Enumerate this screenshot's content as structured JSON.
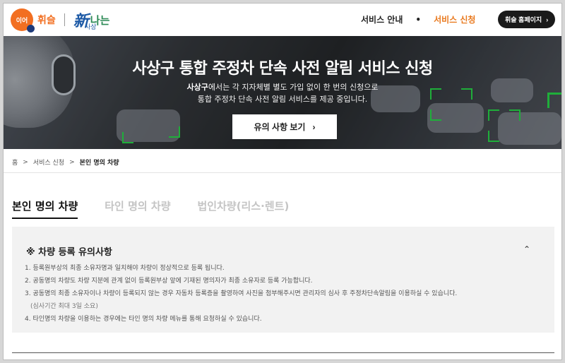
{
  "header": {
    "logo_badge": "이어",
    "logo_name": "휘슬",
    "brand_main": "新",
    "brand_sub": "나는",
    "brand_small": "사상",
    "nav": {
      "service_info": "서비스 안내",
      "service_apply": "서비스 신청"
    },
    "home_button": "휘슬 홈페이지"
  },
  "hero": {
    "title": "사상구 통합 주정차 단속 사전 알림 서비스 신청",
    "desc_bold": "사상구",
    "desc_line1": "에서는 각 지자체별 별도 가입 없이 한 번의 신청으로",
    "desc_line2": "통합 주정차 단속 사전 알림 서비스를 제공 중입니다.",
    "button": "유의 사항 보기"
  },
  "breadcrumb": {
    "home": "홈",
    "level1": "서비스 신청",
    "current": "본인 명의 차량"
  },
  "tabs": [
    "본인 명의 차량",
    "타인 명의 차량",
    "법인차량(리스·렌트)"
  ],
  "notice": {
    "title": "※ 차량 등록 유의사항",
    "items": [
      "1. 등록원부상의 최종 소유자명과 일치해야 차량이 정상적으로 등록 됩니다.",
      "2. 공동명의 차량도 차량 지분에 관계 없이 등록원부상 앞에 기재된 명의자가 최종 소유자로 등록 가능합니다.",
      "3. 공동명의 최종 소유자이나 차량이 등록되지 않는 경우 자동차 등록증을 촬영하여 사진을 첨부해주시면 관리자의 심사 후 주정차단속알림을 이용하실 수 있습니다.",
      "(심사기간 최대 3일 소요)",
      "4. 타인명의 차량을 이용하는 경우에는 타인 명의 차량 메뉴를 통해 요청하실 수 있습니다."
    ]
  },
  "colors": {
    "accent": "#e9791e",
    "bracket": "#1fae3a",
    "brand_blue": "#1d5aa6"
  }
}
